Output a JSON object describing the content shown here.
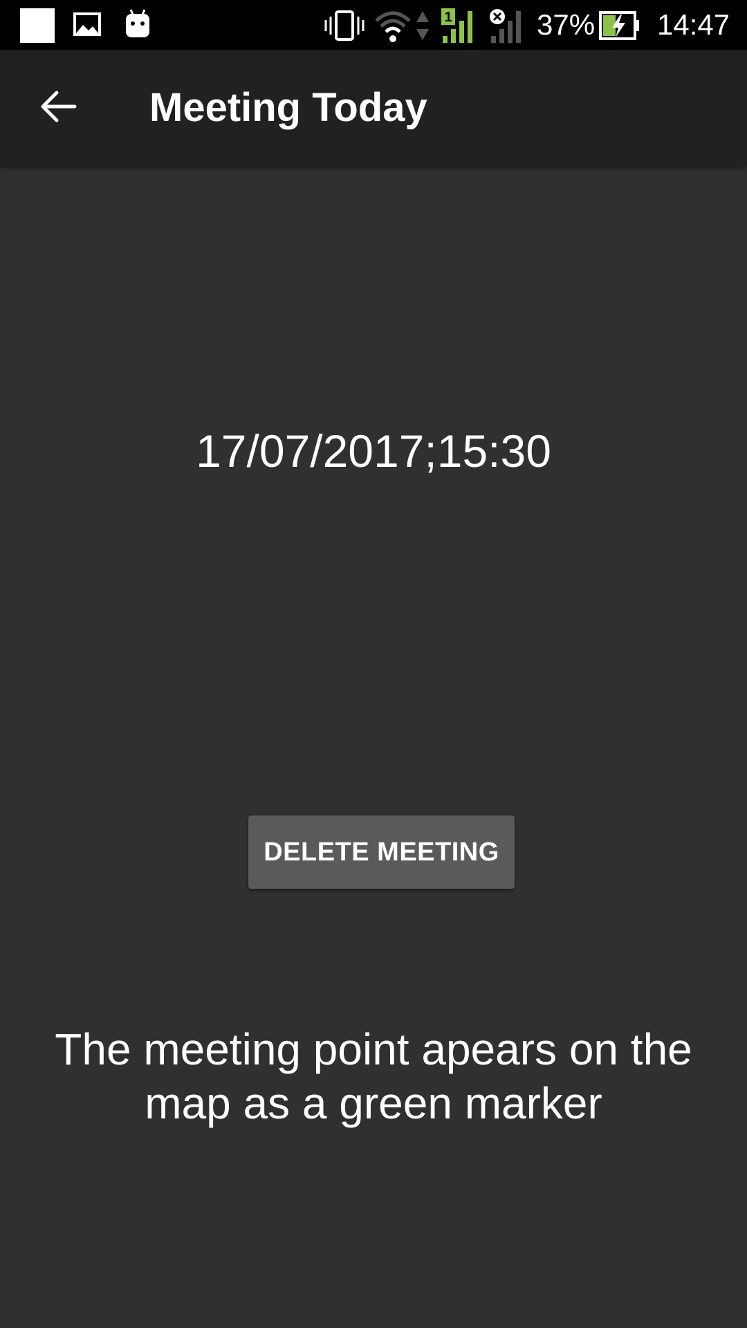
{
  "status_bar": {
    "battery_percent": "37%",
    "time": "14:47",
    "sim_label": "1",
    "icons": [
      "notification-square-icon",
      "image-icon",
      "android-icon",
      "vibrate-icon",
      "wifi-icon",
      "data-arrows-icon",
      "signal-sim1-icon",
      "signal-sim2-no-service-icon",
      "battery-charging-icon"
    ],
    "colors": {
      "signal_active": "#8bc34a",
      "battery_bolt": "#8bc34a"
    }
  },
  "app_bar": {
    "title": "Meeting Today",
    "back_icon": "arrow-back-icon"
  },
  "meeting": {
    "datetime": "17/07/2017;15:30",
    "delete_label": "DELETE MEETING",
    "info": "The meeting point apears on the map as a green marker"
  },
  "colors": {
    "background": "#303030",
    "app_bar": "#212121",
    "button": "#5a5a5a",
    "text": "#ffffff"
  }
}
